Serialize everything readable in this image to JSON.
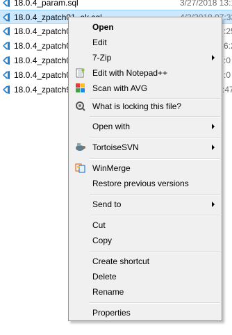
{
  "files": [
    {
      "name": "18.0.4_param.sql",
      "date": "3/27/2018 13:1",
      "selected": false
    },
    {
      "name": "18.0.4_zpatch01_ok.sql",
      "date": "4/3/2018 07:33",
      "selected": true
    },
    {
      "name": "18.0.4_zpatch02",
      "date": ":25",
      "selected": false
    },
    {
      "name": "18.0.4_zpatch03",
      "date": "6:2",
      "selected": false
    },
    {
      "name": "18.0.4_zpatch04",
      "date": ":0",
      "selected": false
    },
    {
      "name": "18.0.4_zpatch05",
      "date": ":0",
      "selected": false
    },
    {
      "name": "18.0.4_zpatch99",
      "date": ":47",
      "selected": false
    }
  ],
  "menu": {
    "open": "Open",
    "edit": "Edit",
    "seven_zip": "7-Zip",
    "edit_notepad": "Edit with Notepad++",
    "scan_avg": "Scan with AVG",
    "locking": "What is locking this file?",
    "open_with": "Open with",
    "tortoise": "TortoiseSVN",
    "winmerge": "WinMerge",
    "restore": "Restore previous versions",
    "send_to": "Send to",
    "cut": "Cut",
    "copy": "Copy",
    "create_shortcut": "Create shortcut",
    "delete": "Delete",
    "rename": "Rename",
    "properties": "Properties"
  },
  "icons": {
    "file": "vscode-file-icon",
    "notepad": "notepad-plus-icon",
    "avg": "avg-icon",
    "locking": "magnifier-gear-icon",
    "tortoise": "tortoise-svn-icon",
    "winmerge": "winmerge-icon"
  }
}
